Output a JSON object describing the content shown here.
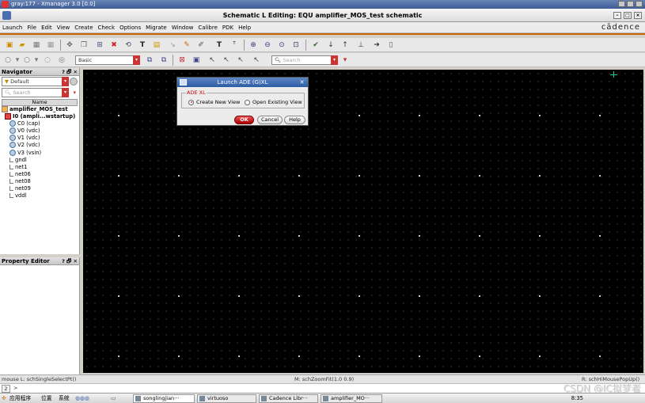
{
  "xmanager": {
    "title": "gray:177 - Xmanager 3.0 [0.0]"
  },
  "window": {
    "title": "Schematic L Editing: EQU amplifier_MOS_test schematic"
  },
  "menu": {
    "items": [
      "Launch",
      "File",
      "Edit",
      "View",
      "Create",
      "Check",
      "Options",
      "Migrate",
      "Window",
      "Calibre",
      "PDK",
      "Help"
    ],
    "brand": "cādence"
  },
  "toolbar2": {
    "workspace": "Basic",
    "search_placeholder": "Search"
  },
  "navigator": {
    "title": "Navigator",
    "buttons": "? 🗗 ✕",
    "filter": "Default",
    "search_placeholder": "Search",
    "column": "Name",
    "tree": [
      {
        "label": "amplifier_MOS_test",
        "kind": "cell"
      },
      {
        "label": "I0 (ampli...wstartup)",
        "kind": "inst"
      },
      {
        "label": "C0 (cap)",
        "kind": "src"
      },
      {
        "label": "V0 (vdc)",
        "kind": "src"
      },
      {
        "label": "V1 (vdc)",
        "kind": "src"
      },
      {
        "label": "V2 (vdc)",
        "kind": "src"
      },
      {
        "label": "V3 (vsin)",
        "kind": "src"
      },
      {
        "label": "gndl",
        "kind": "net"
      },
      {
        "label": "net1",
        "kind": "net"
      },
      {
        "label": "net06",
        "kind": "net"
      },
      {
        "label": "net08",
        "kind": "net"
      },
      {
        "label": "net09",
        "kind": "net"
      },
      {
        "label": "vddl",
        "kind": "net"
      }
    ]
  },
  "property_editor": {
    "title": "Property Editor",
    "buttons": "? 🗗 ✕"
  },
  "dialog": {
    "title": "Launch ADE (G)XL",
    "group": "ADE XL",
    "option_new": "Create New View",
    "option_open": "Open Existing View",
    "ok": "OK",
    "cancel": "Cancel",
    "help": "Help"
  },
  "status": {
    "left": "mouse L: schSingleSelectPt()",
    "middle": "M: schZoomFit(1.0 0.9)",
    "right": "R: schHiMousePopUp()"
  },
  "cmdline": {
    "number": "2",
    "prompt": ">"
  },
  "watermark": "CSDN @IC拟梦者",
  "taskbar": {
    "apps": "应用程序",
    "places": "位置",
    "system": "系统",
    "tasks": [
      "songlingjian···",
      "virtuoso",
      "Cadence Libr···",
      "amplifier_MO···"
    ],
    "clock": "8:35"
  }
}
